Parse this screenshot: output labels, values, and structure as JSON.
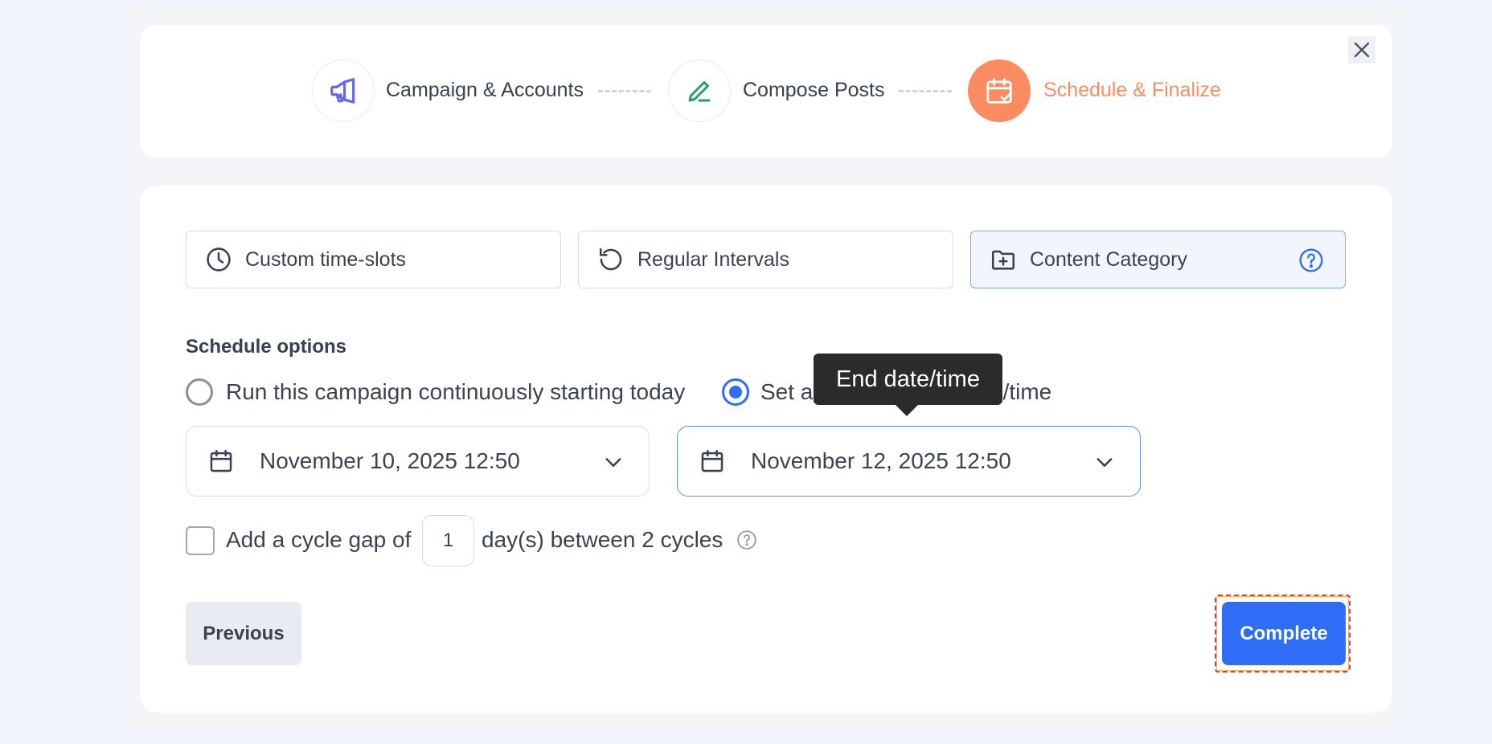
{
  "stepper": {
    "steps": [
      {
        "label": "Campaign & Accounts",
        "icon": "megaphone-icon",
        "state": "done"
      },
      {
        "label": "Compose Posts",
        "icon": "pencil-icon",
        "state": "done"
      },
      {
        "label": "Schedule & Finalize",
        "icon": "calendar-check-icon",
        "state": "active"
      }
    ],
    "close_icon": "close-icon"
  },
  "schedule_tabs": [
    {
      "label": "Custom time-slots",
      "icon": "clock-icon",
      "selected": false
    },
    {
      "label": "Regular Intervals",
      "icon": "refresh-icon",
      "selected": false
    },
    {
      "label": "Content Category",
      "icon": "folder-plus-icon",
      "selected": true
    }
  ],
  "schedule_options": {
    "title": "Schedule options",
    "option_continuous": "Run this campaign continuously starting today",
    "option_end_prefix": "Set a",
    "option_end_suffix": "e/time",
    "selected": "end",
    "tooltip": "End date/time",
    "start_date": "November 10, 2025 12:50",
    "end_date": "November 12, 2025 12:50"
  },
  "cycle_gap": {
    "checked": false,
    "prefix": "Add a cycle gap of",
    "value": "1",
    "suffix": "day(s) between 2 cycles"
  },
  "actions": {
    "previous": "Previous",
    "complete": "Complete"
  },
  "colors": {
    "accent": "#2f6df6",
    "active_step": "#fb8c61",
    "megaphone": "#6366f1",
    "pencil": "#22a06b"
  }
}
